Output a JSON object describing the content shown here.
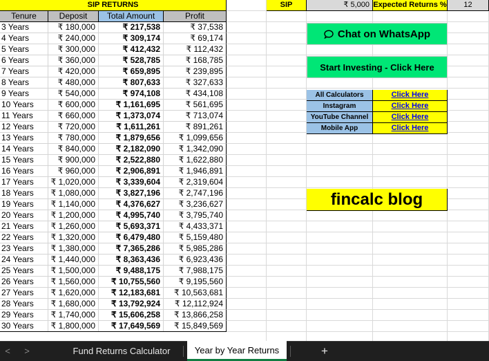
{
  "sheet": {
    "title": "SIP RETURNS",
    "headers": [
      "Tenure",
      "Deposit",
      "Total Amount",
      "Profit"
    ],
    "rows": [
      [
        "3 Years",
        "₹ 180,000",
        "₹ 217,538",
        "₹ 37,538"
      ],
      [
        "4 Years",
        "₹ 240,000",
        "₹ 309,174",
        "₹ 69,174"
      ],
      [
        "5 Years",
        "₹ 300,000",
        "₹ 412,432",
        "₹ 112,432"
      ],
      [
        "6 Years",
        "₹ 360,000",
        "₹ 528,785",
        "₹ 168,785"
      ],
      [
        "7 Years",
        "₹ 420,000",
        "₹ 659,895",
        "₹ 239,895"
      ],
      [
        "8 Years",
        "₹ 480,000",
        "₹ 807,633",
        "₹ 327,633"
      ],
      [
        "9 Years",
        "₹ 540,000",
        "₹ 974,108",
        "₹ 434,108"
      ],
      [
        "10 Years",
        "₹ 600,000",
        "₹ 1,161,695",
        "₹ 561,695"
      ],
      [
        "11 Years",
        "₹ 660,000",
        "₹ 1,373,074",
        "₹ 713,074"
      ],
      [
        "12 Years",
        "₹ 720,000",
        "₹ 1,611,261",
        "₹ 891,261"
      ],
      [
        "13 Years",
        "₹ 780,000",
        "₹ 1,879,656",
        "₹ 1,099,656"
      ],
      [
        "14 Years",
        "₹ 840,000",
        "₹ 2,182,090",
        "₹ 1,342,090"
      ],
      [
        "15 Years",
        "₹ 900,000",
        "₹ 2,522,880",
        "₹ 1,622,880"
      ],
      [
        "16 Years",
        "₹ 960,000",
        "₹ 2,906,891",
        "₹ 1,946,891"
      ],
      [
        "17 Years",
        "₹ 1,020,000",
        "₹ 3,339,604",
        "₹ 2,319,604"
      ],
      [
        "18 Years",
        "₹ 1,080,000",
        "₹ 3,827,196",
        "₹ 2,747,196"
      ],
      [
        "19 Years",
        "₹ 1,140,000",
        "₹ 4,376,627",
        "₹ 3,236,627"
      ],
      [
        "20 Years",
        "₹ 1,200,000",
        "₹ 4,995,740",
        "₹ 3,795,740"
      ],
      [
        "21 Years",
        "₹ 1,260,000",
        "₹ 5,693,371",
        "₹ 4,433,371"
      ],
      [
        "22 Years",
        "₹ 1,320,000",
        "₹ 6,479,480",
        "₹ 5,159,480"
      ],
      [
        "23 Years",
        "₹ 1,380,000",
        "₹ 7,365,286",
        "₹ 5,985,286"
      ],
      [
        "24 Years",
        "₹ 1,440,000",
        "₹ 8,363,436",
        "₹ 6,923,436"
      ],
      [
        "25 Years",
        "₹ 1,500,000",
        "₹ 9,488,175",
        "₹ 7,988,175"
      ],
      [
        "26 Years",
        "₹ 1,560,000",
        "₹ 10,755,560",
        "₹ 9,195,560"
      ],
      [
        "27 Years",
        "₹ 1,620,000",
        "₹ 12,183,681",
        "₹ 10,563,681"
      ],
      [
        "28 Years",
        "₹ 1,680,000",
        "₹ 13,792,924",
        "₹ 12,112,924"
      ],
      [
        "29 Years",
        "₹ 1,740,000",
        "₹ 15,606,258",
        "₹ 13,866,258"
      ],
      [
        "30 Years",
        "₹ 1,800,000",
        "₹ 17,649,569",
        "₹ 15,849,569"
      ]
    ]
  },
  "inputs": {
    "sip_label": "SIP",
    "sip_value": "₹ 5,000",
    "returns_label": "Expected Returns %",
    "returns_value": "12"
  },
  "buttons": {
    "whatsapp": "Chat on WhatsApp",
    "invest": "Start Investing - Click Here"
  },
  "links": [
    {
      "label": "All Calculators",
      "link": "Click Here"
    },
    {
      "label": "Instagram",
      "link": "Click Here"
    },
    {
      "label": "YouTube Channel",
      "link": "Click Here"
    },
    {
      "label": "Mobile App",
      "link": "Click Here"
    }
  ],
  "brand": "fincalc blog",
  "tabs": {
    "prev": "<",
    "next": ">",
    "items": [
      "Fund Returns Calculator",
      "Year by Year Returns"
    ],
    "active": "Year by Year Returns",
    "add": "+"
  },
  "colors": {
    "header_yellow": "#ffff00",
    "header_grey": "#bfbfbf",
    "total_blue": "#9bc2e6",
    "button_green": "#00e676",
    "excel_green": "#107c41"
  }
}
